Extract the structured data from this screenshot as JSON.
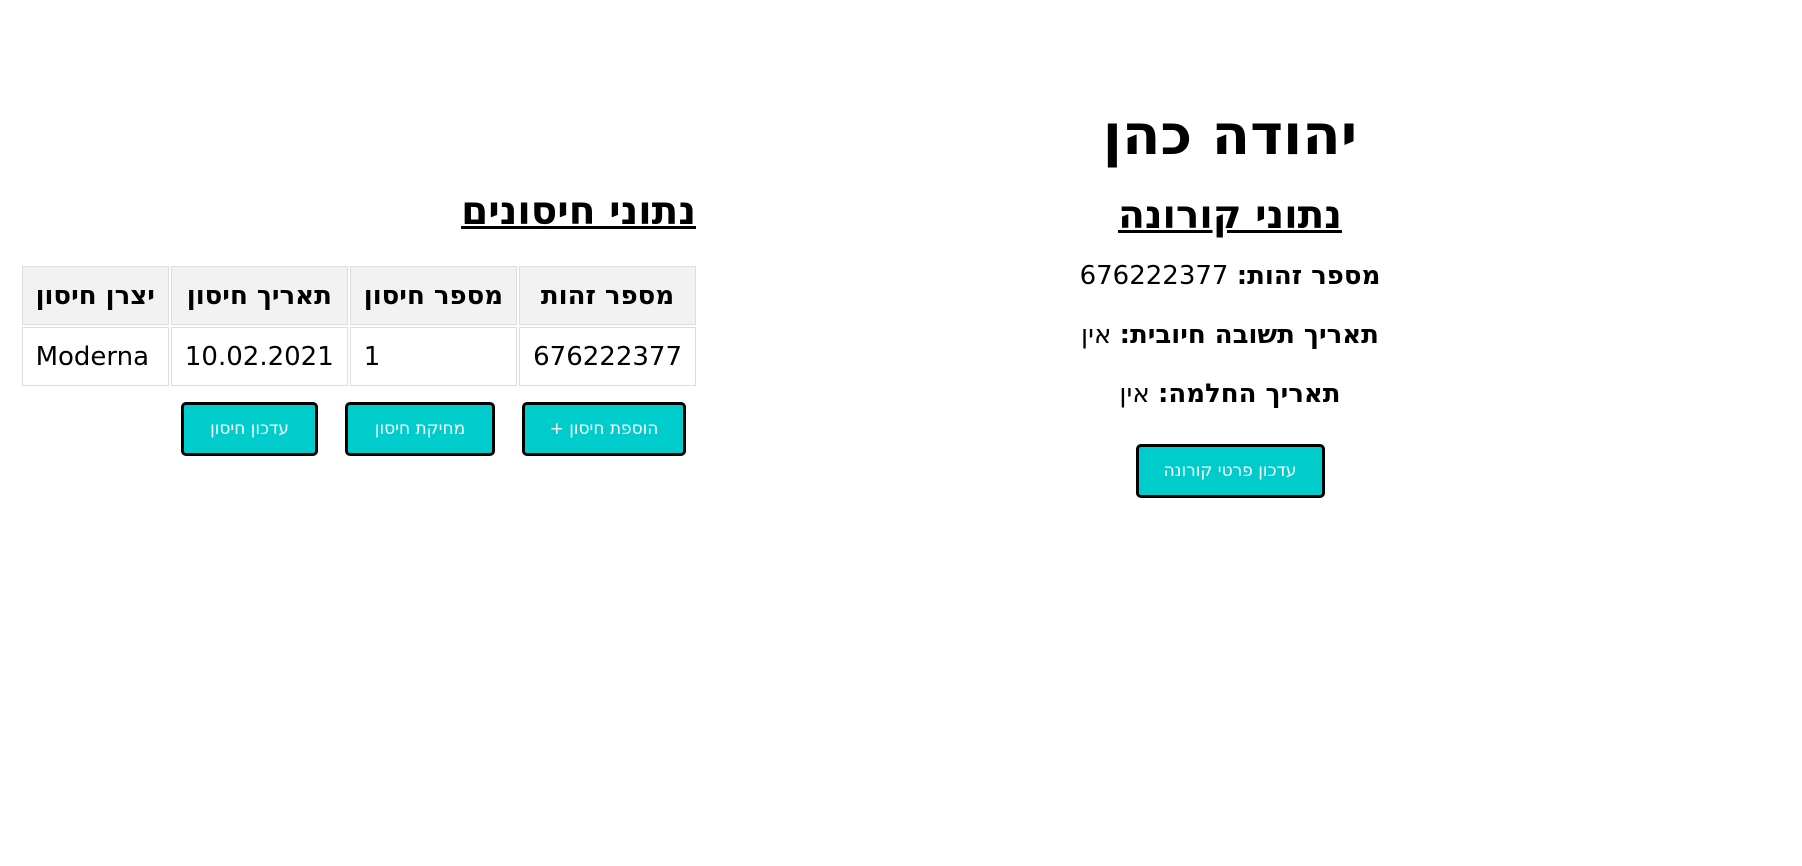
{
  "person": {
    "name": "יהודה כהן"
  },
  "corona": {
    "title": "נתוני קורונה",
    "fields": [
      {
        "label": "מספר זהות:",
        "value": "676222377"
      },
      {
        "label": "תאריך תשובה חיובית:",
        "value": "אין"
      },
      {
        "label": "תאריך החלמה:",
        "value": "אין"
      }
    ],
    "update_button": "עדכון פרטי קורונה"
  },
  "vaccines": {
    "title": "נתוני חיסונים",
    "columns": [
      "מספר זהות",
      "מספר חיסון",
      "תאריך חיסון",
      "יצרן חיסון"
    ],
    "rows": [
      [
        "676222377",
        "1",
        "10.02.2021",
        "Moderna"
      ]
    ],
    "buttons": {
      "add": "הוספת חיסון +",
      "delete": "מחיקת חיסון",
      "update": "עדכון חיסון"
    }
  },
  "colors": {
    "button_bg": "#00cccc",
    "button_border": "#000000",
    "header_bg": "#f2f2f2"
  }
}
